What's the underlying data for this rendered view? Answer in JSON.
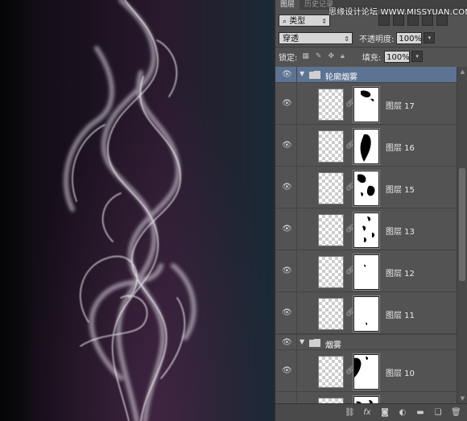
{
  "canvas": {},
  "panel": {
    "tabs": [
      {
        "label": "图层",
        "active": true
      },
      {
        "label": "历史记录",
        "active": false
      }
    ],
    "watermark": "思缘设计论坛 WWW.MISSYUAN.COM",
    "filter": {
      "label": "类型"
    },
    "blend_mode": "穿透",
    "opacity": {
      "label": "不透明度:",
      "value": "100%"
    },
    "lock": {
      "label": "锁定:"
    },
    "fill": {
      "label": "填充:",
      "value": "100%"
    },
    "layers": [
      {
        "type": "group",
        "name": "轮廓烟雾",
        "expanded": true,
        "selected": true
      },
      {
        "type": "layer",
        "name": "图层 17"
      },
      {
        "type": "layer",
        "name": "图层 16"
      },
      {
        "type": "layer",
        "name": "图层 15"
      },
      {
        "type": "layer",
        "name": "图层 13"
      },
      {
        "type": "layer",
        "name": "图层 12"
      },
      {
        "type": "layer",
        "name": "图层 11"
      },
      {
        "type": "group",
        "name": "烟雾",
        "expanded": true,
        "selected": false
      },
      {
        "type": "layer",
        "name": "图层 10"
      },
      {
        "type": "layer",
        "name": ""
      }
    ],
    "bottom_icons": [
      "link-icon",
      "fx-icon",
      "mask-icon",
      "adjustment-icon",
      "folder-icon",
      "new-layer-icon",
      "trash-icon"
    ]
  },
  "colors": {
    "panel_bg": "#535353",
    "selected_group": "#5d7393",
    "canvas_dark": "#0d0a10"
  }
}
